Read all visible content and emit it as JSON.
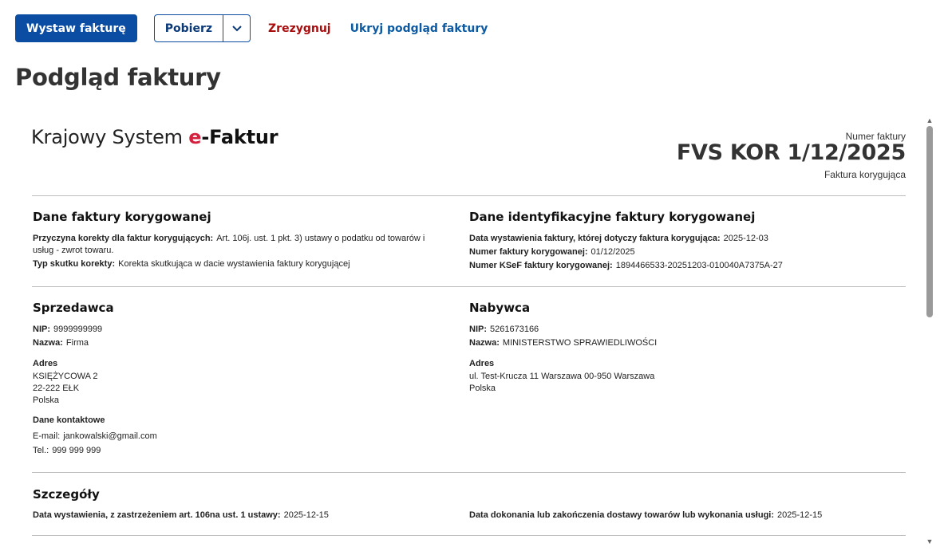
{
  "toolbar": {
    "issue_label": "Wystaw fakturę",
    "download_label": "Pobierz",
    "cancel_label": "Zrezygnuj",
    "hide_preview_label": "Ukryj podgląd faktury"
  },
  "page_title": "Podgląd faktury",
  "brand": {
    "prefix": "Krajowy System ",
    "e": "e",
    "suffix": "-Faktur"
  },
  "invoice": {
    "number_label": "Numer faktury",
    "number": "FVS KOR 1/12/2025",
    "type": "Faktura korygująca"
  },
  "corrected": {
    "title": "Dane faktury korygowanej",
    "reason_label": "Przyczyna korekty dla faktur korygujących:",
    "reason_value_line1": "Art. 106j. ust. 1 pkt. 3) ustawy o podatku od towarów i",
    "reason_value_line2": "usług - zwrot towaru.",
    "effect_label": "Typ skutku korekty:",
    "effect_value": "Korekta skutkująca w dacie wystawienia faktury korygującej"
  },
  "corrected_id": {
    "title": "Dane identyfikacyjne faktury korygowanej",
    "date_label": "Data wystawienia faktury, której dotyczy faktura korygująca:",
    "date_value": "2025-12-03",
    "number_label": "Numer faktury korygowanej:",
    "number_value": "01/12/2025",
    "ksef_label": "Numer KSeF faktury korygowanej:",
    "ksef_value": "1894466533-20251203-010040A7375A-27"
  },
  "seller": {
    "title": "Sprzedawca",
    "nip_label": "NIP:",
    "nip_value": "9999999999",
    "name_label": "Nazwa:",
    "name_value": "Firma",
    "address_title": "Adres",
    "address_line1": "KSIĘŻYCOWA 2",
    "address_line2": "22-222 EŁK",
    "address_line3": "Polska",
    "contact_title": "Dane kontaktowe",
    "email_label": "E-mail:",
    "email_value": "jankowalski@gmail.com",
    "phone_label": "Tel.:",
    "phone_value": "999 999 999"
  },
  "buyer": {
    "title": "Nabywca",
    "nip_label": "NIP:",
    "nip_value": "5261673166",
    "name_label": "Nazwa:",
    "name_value": "MINISTERSTWO SPRAWIEDLIWOŚCI",
    "address_title": "Adres",
    "address_line1": "ul. Test-Krucza 11 Warszawa 00-950 Warszawa",
    "address_line2": "Polska"
  },
  "details": {
    "title": "Szczegóły",
    "issue_date_label": "Data wystawienia, z zastrzeżeniem art. 106na ust. 1 ustawy:",
    "issue_date_value": "2025-12-15",
    "delivery_date_label": "Data dokonania lub zakończenia dostawy towarów lub wykonania usługi:",
    "delivery_date_value": "2025-12-15"
  }
}
